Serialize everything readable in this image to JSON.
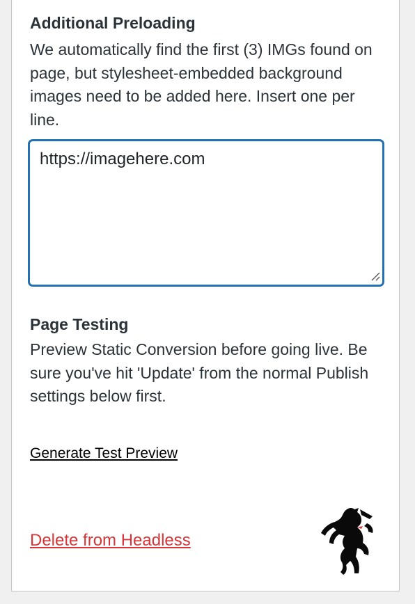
{
  "preloading": {
    "title": "Additional Preloading",
    "description": "We automatically find the first (3) IMGs found on page, but stylesheet-embedded background images need to be added here. Insert one per line.",
    "textarea_value": "https://imagehere.com"
  },
  "testing": {
    "title": "Page Testing",
    "description": "Preview Static Conversion before going live. Be sure you've hit 'Update' from the normal Publish settings below first.",
    "preview_link": "Generate Test Preview"
  },
  "delete_link": "Delete from Headless",
  "logo_icon": "rearing-horse-icon",
  "colors": {
    "accent": "#2271b1",
    "danger": "#d63638"
  }
}
